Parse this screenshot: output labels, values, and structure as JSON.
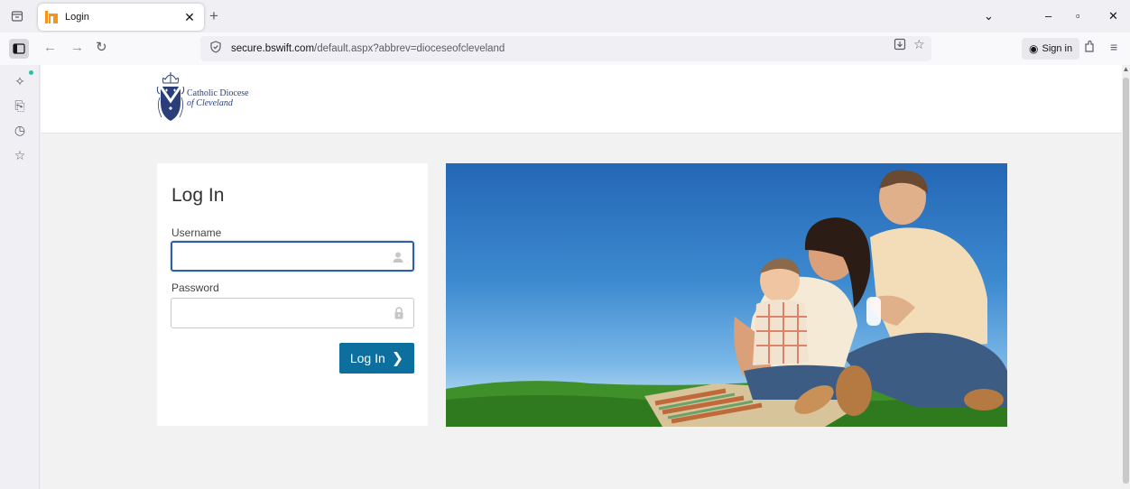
{
  "browser": {
    "tab": {
      "title": "Login"
    },
    "url": {
      "domain": "secure.bswift.com",
      "path": "/default.aspx?abbrev=dioceseofcleveland"
    },
    "signin_label": "Sign in"
  },
  "header": {
    "logo_line1": "Catholic Diocese",
    "logo_line2": "of Cleveland"
  },
  "login": {
    "title": "Log In",
    "username_label": "Username",
    "username_value": "",
    "password_label": "Password",
    "password_value": "",
    "submit_label": "Log In"
  },
  "colors": {
    "accent": "#0c6f9e",
    "focus_border": "#2f5ea8",
    "logo_blue": "#2a3f7a"
  }
}
